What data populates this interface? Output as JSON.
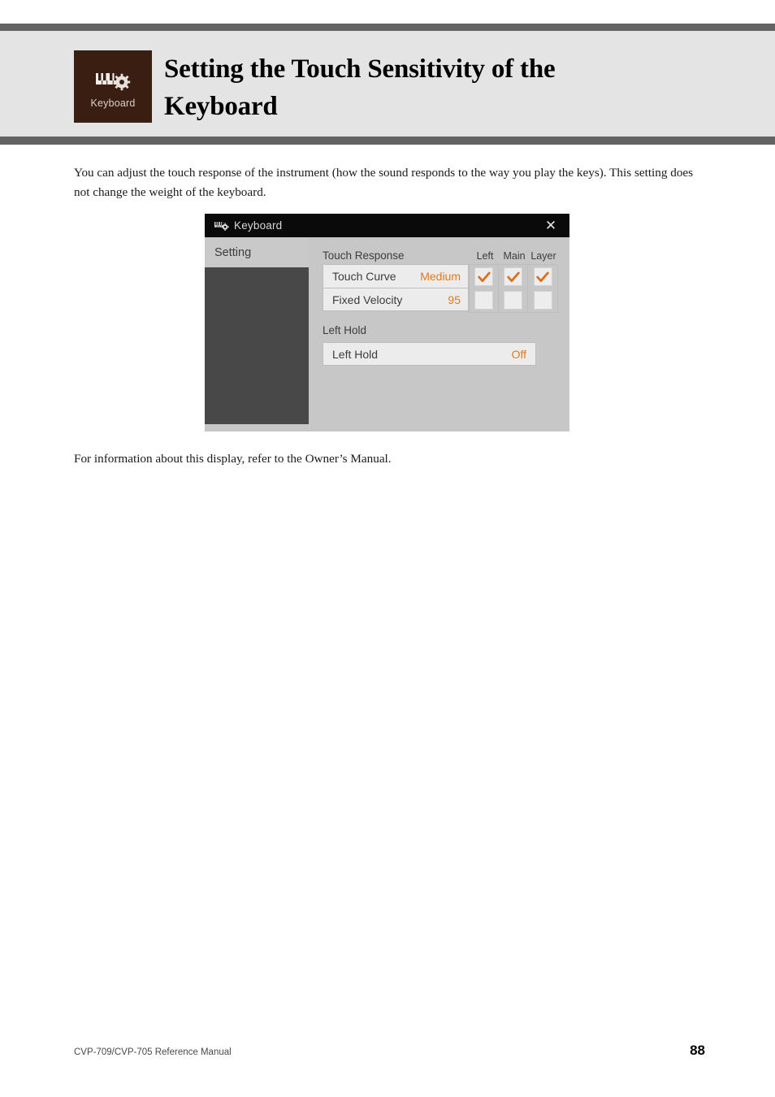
{
  "page": {
    "title": "Setting the Touch Sensitivity of the Keyboard",
    "chapter_icon_label": "Keyboard",
    "chapter_icon_name": "keyboard-gear-icon",
    "intro_paragraph": "You can adjust the touch response of the instrument (how the sound responds to the way you play the keys). This setting does not change the weight of the keyboard.",
    "outro_paragraph": "For information about this display, refer to the Owner’s Manual.",
    "footer_left": "CVP-709/CVP-705 Reference Manual",
    "footer_page_number": "88"
  },
  "colors": {
    "rule_gray": "#636363",
    "header_band": "#e4e4e4",
    "icon_tile_brown": "#3a1e12",
    "accent_orange": "#e0791c",
    "dialog_bg": "#c7c7c7",
    "dialog_titlebar": "#0a0a0a",
    "sidebar_panel": "#484848",
    "row_bg": "#ececec"
  },
  "dialog": {
    "titlebar": {
      "icon_name": "keyboard-gear-icon",
      "title": "Keyboard",
      "close_label": "✕"
    },
    "sidebar": {
      "tabs": [
        {
          "label": "Setting",
          "active": true
        }
      ]
    },
    "touch_response": {
      "section_label": "Touch Response",
      "column_headers": [
        "Left",
        "Main",
        "Layer"
      ],
      "rows": [
        {
          "label": "Touch Curve",
          "value": "Medium",
          "checks": [
            true,
            true,
            true
          ]
        },
        {
          "label": "Fixed Velocity",
          "value": "95",
          "checks": [
            false,
            false,
            false
          ]
        }
      ]
    },
    "left_hold": {
      "section_label": "Left Hold",
      "row": {
        "label": "Left Hold",
        "value": "Off"
      }
    }
  }
}
